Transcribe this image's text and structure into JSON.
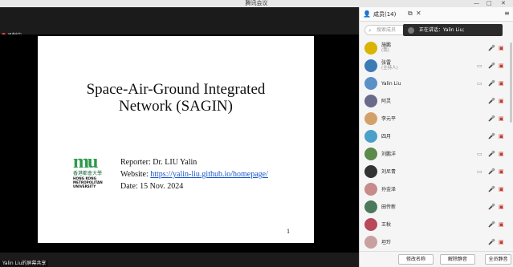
{
  "window": {
    "title": "腾讯会议",
    "min": "—",
    "max": "□",
    "close": "✕"
  },
  "stage": {
    "recording": "录制中",
    "slide": {
      "title_line1": "Space-Air-Ground Integrated",
      "title_line2": "Network (SAGIN)",
      "logo_mark": "mu",
      "logo_cn": "香港都會大學",
      "logo_en1": "HONG KONG",
      "logo_en2": "METROPOLITAN",
      "logo_en3": "UNIVERSITY",
      "reporter": "Reporter: Dr. LIU Yalin",
      "website_label": "Website: ",
      "website_url": "https://yalin-liu.github.io/homepage/",
      "date": "Date: 15 Nov. 2024",
      "page": "1"
    },
    "share_label": "Yalin Liu的屏幕共享"
  },
  "panel": {
    "title": "成员(14)",
    "search_placeholder": "搜索成员",
    "speaking": "正在讲话：Yalin Liu;",
    "members": [
      {
        "name": "施鹏",
        "role": "(我)",
        "color": "#d9b400",
        "dev": "",
        "mic": "🎤",
        "cam": "▣"
      },
      {
        "name": "张雷",
        "role": "(主持人)",
        "color": "#3b7bb6",
        "dev": "▭",
        "mic": "🎤",
        "cam": "▣"
      },
      {
        "name": "Yalin Liu",
        "role": "",
        "color": "#5a8fc8",
        "dev": "▭",
        "mic": "🎤",
        "cam": "▣",
        "micOn": true
      },
      {
        "name": "阿灵",
        "role": "",
        "color": "#6a6a8a",
        "dev": "",
        "mic": "🎤",
        "cam": "▣"
      },
      {
        "name": "李元平",
        "role": "",
        "color": "#d4a06a",
        "dev": "",
        "mic": "🎤",
        "cam": "▣"
      },
      {
        "name": "四月",
        "role": "",
        "color": "#4aa0c8",
        "dev": "",
        "mic": "🎤",
        "cam": "▣"
      },
      {
        "name": "刘鹏洋",
        "role": "",
        "color": "#5b8a4a",
        "dev": "▭",
        "mic": "🎤",
        "cam": "▣"
      },
      {
        "name": "刘尼青",
        "role": "",
        "color": "#333333",
        "dev": "▭",
        "mic": "🎤",
        "cam": "▣"
      },
      {
        "name": "孙金泽",
        "role": "",
        "color": "#c88a8a",
        "dev": "",
        "mic": "🎤",
        "cam": "▣"
      },
      {
        "name": "田传新",
        "role": "",
        "color": "#4a7a5a",
        "dev": "",
        "mic": "🎤",
        "cam": "▣"
      },
      {
        "name": "王秋",
        "role": "",
        "color": "#b84a5a",
        "dev": "",
        "mic": "🎤",
        "cam": "▣"
      },
      {
        "name": "坦玲",
        "role": "",
        "color": "#c8a0a0",
        "dev": "",
        "mic": "🎤",
        "cam": "▣"
      }
    ],
    "rename": "修改名称",
    "unmute_all": "解除静音",
    "all_mute": "全员静音"
  }
}
